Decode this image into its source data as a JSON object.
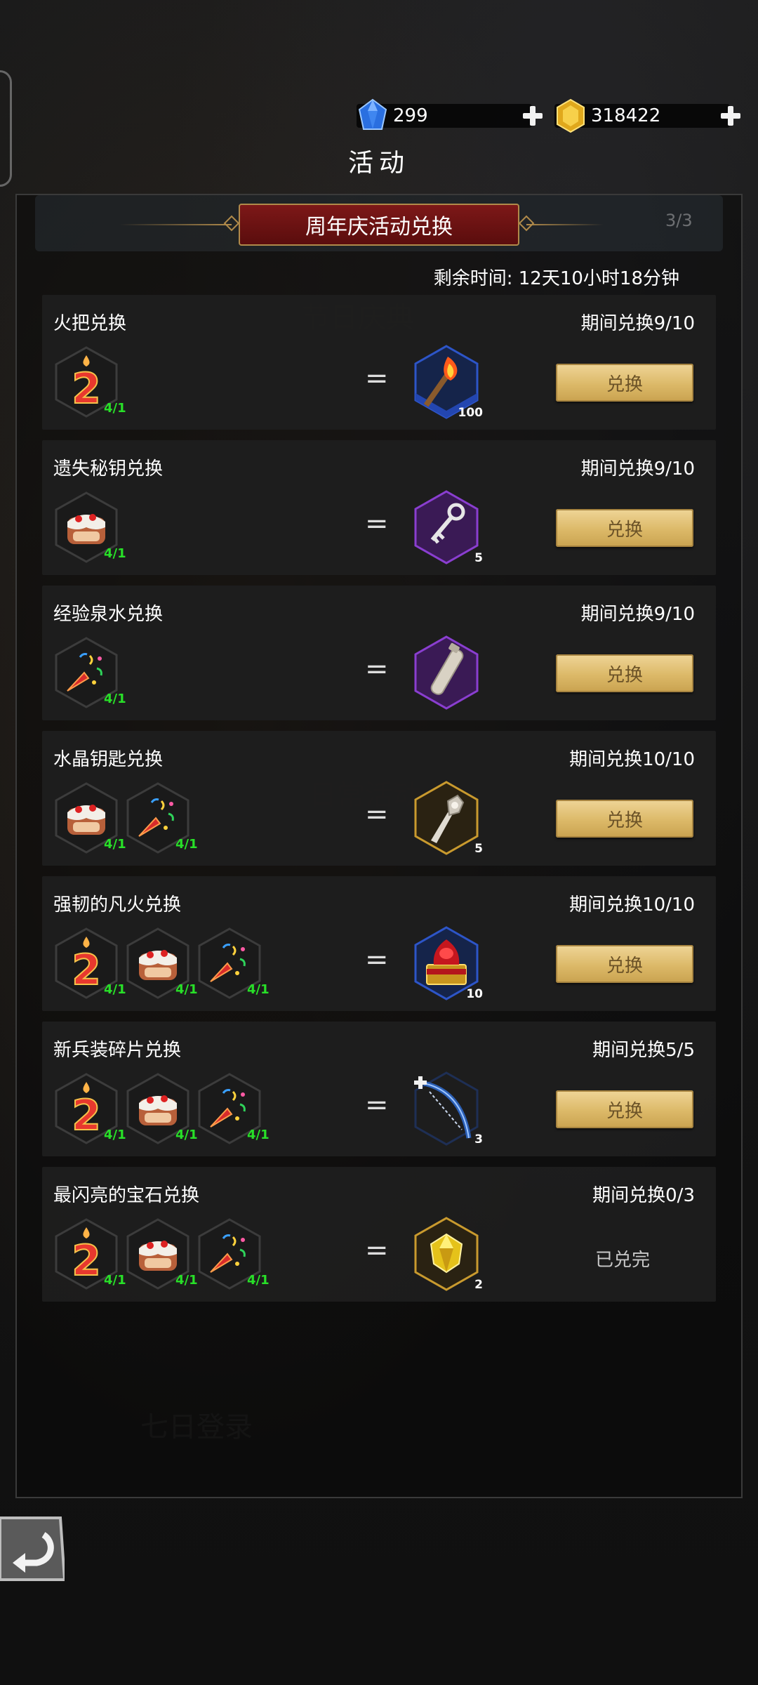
{
  "currency": {
    "diamonds": "299",
    "gold": "318422"
  },
  "window_title": "活动",
  "panel": {
    "title": "周年庆活动兑换",
    "page_indicator": "3/3",
    "remaining_time": "剩余时间: 12天10小时18分钟"
  },
  "exchange_button_label": "兑换",
  "completed_label": "已兑完",
  "rows": [
    {
      "name": "火把兑换",
      "limit": "期间兑换9/10",
      "costs": [
        {
          "icon": "candle-two-icon",
          "qty": "4/1"
        }
      ],
      "reward": {
        "icon": "torch-icon",
        "count": "100"
      },
      "status": "兑换"
    },
    {
      "name": "遗失秘钥兑换",
      "limit": "期间兑换9/10",
      "costs": [
        {
          "icon": "cake-icon",
          "qty": "4/1"
        }
      ],
      "reward": {
        "icon": "key-icon",
        "count": "5"
      },
      "status": "兑换"
    },
    {
      "name": "经验泉水兑换",
      "limit": "期间兑换9/10",
      "costs": [
        {
          "icon": "party-popper-icon",
          "qty": "4/1"
        }
      ],
      "reward": {
        "icon": "scroll-vial-icon",
        "count": ""
      },
      "status": "兑换"
    },
    {
      "name": "水晶钥匙兑换",
      "limit": "期间兑换10/10",
      "costs": [
        {
          "icon": "cake-icon",
          "qty": "4/1"
        },
        {
          "icon": "party-popper-icon",
          "qty": "4/1"
        }
      ],
      "reward": {
        "icon": "crystal-key-icon",
        "count": "5"
      },
      "status": "兑换"
    },
    {
      "name": "强韧的凡火兑换",
      "limit": "期间兑换10/10",
      "costs": [
        {
          "icon": "candle-two-icon",
          "qty": "4/1"
        },
        {
          "icon": "cake-icon",
          "qty": "4/1"
        },
        {
          "icon": "party-popper-icon",
          "qty": "4/1"
        }
      ],
      "reward": {
        "icon": "fire-chest-icon",
        "count": "10"
      },
      "status": "兑换"
    },
    {
      "name": "新兵装碎片兑换",
      "limit": "期间兑换5/5",
      "costs": [
        {
          "icon": "candle-two-icon",
          "qty": "4/1"
        },
        {
          "icon": "cake-icon",
          "qty": "4/1"
        },
        {
          "icon": "party-popper-icon",
          "qty": "4/1"
        }
      ],
      "reward": {
        "icon": "crossbow-fragment-icon",
        "count": "3"
      },
      "status": "兑换"
    },
    {
      "name": "最闪亮的宝石兑换",
      "limit": "期间兑换0/3",
      "costs": [
        {
          "icon": "candle-two-icon",
          "qty": "4/1"
        },
        {
          "icon": "cake-icon",
          "qty": "4/1"
        },
        {
          "icon": "party-popper-icon",
          "qty": "4/1"
        }
      ],
      "reward": {
        "icon": "yellow-gem-icon",
        "count": "2"
      },
      "status": "已兑完"
    }
  ],
  "colors": {
    "button_gold": "#dcb968",
    "banner_red": "#7d1818",
    "qty_green": "#28e028"
  }
}
